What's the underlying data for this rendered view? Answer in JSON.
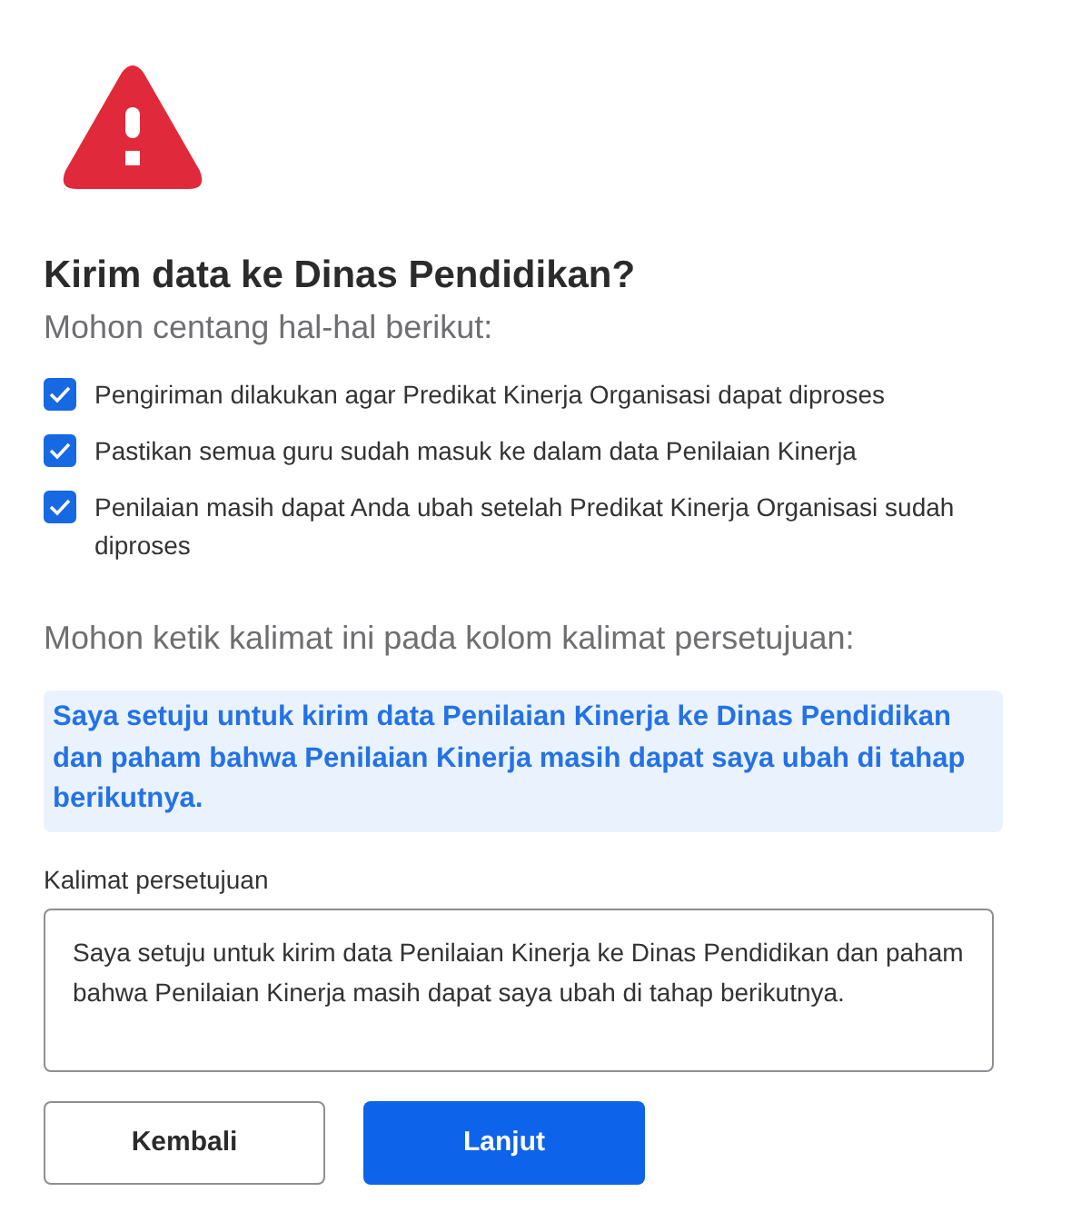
{
  "dialog": {
    "title": "Kirim data ke Dinas Pendidikan?",
    "instruction": "Mohon centang hal-hal berikut:",
    "checklist": [
      {
        "label": "Pengiriman dilakukan agar Predikat Kinerja Organisasi dapat diproses",
        "checked": true
      },
      {
        "label": "Pastikan semua guru sudah masuk ke dalam data Penilaian Kinerja",
        "checked": true
      },
      {
        "label": "Penilaian masih dapat Anda ubah setelah Predikat Kinerja Organisasi sudah diproses",
        "checked": true
      }
    ],
    "type_instruction": "Mohon ketik kalimat ini pada kolom kalimat persetujuan:",
    "sentence_to_type": "Saya setuju untuk kirim data Penilaian Kinerja ke Dinas Pendidikan dan paham bahwa Penilaian Kinerja masih dapat saya ubah di tahap berikutnya.",
    "field": {
      "label": "Kalimat persetujuan",
      "value": "Saya setuju untuk kirim data Penilaian Kinerja ke Dinas Pendidikan dan paham bahwa Penilaian Kinerja masih dapat saya ubah di tahap berikutnya."
    },
    "buttons": [
      {
        "label": "Kembali",
        "kind": "secondary"
      },
      {
        "label": "Lanjut",
        "kind": "primary"
      }
    ]
  }
}
